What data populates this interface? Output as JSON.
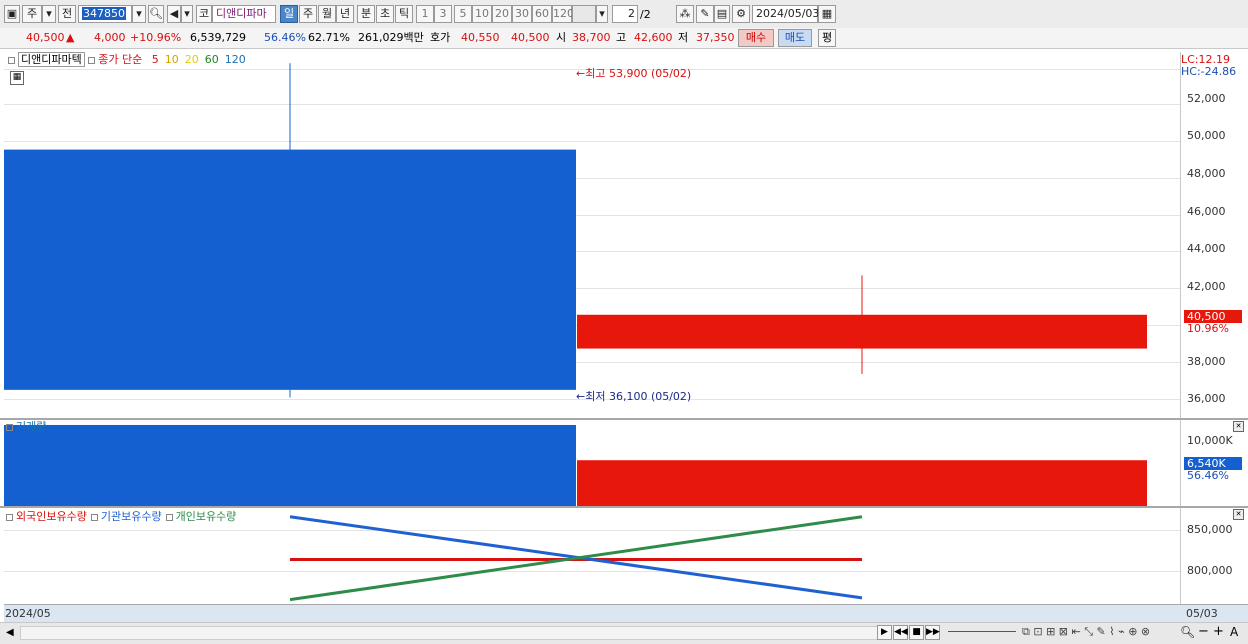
{
  "toolbar": {
    "market": "주",
    "prev_label": "전",
    "stock_code": "347850",
    "code_prefix": "코",
    "stock_name": "디앤디파마",
    "periods": [
      "일",
      "주",
      "월",
      "년",
      "분",
      "초",
      "틱"
    ],
    "intervals": [
      "1",
      "3",
      "5",
      "10",
      "20",
      "30",
      "60",
      "120"
    ],
    "page": "2",
    "page_total": "/2",
    "date": "2024/05/03"
  },
  "quote": {
    "price": "40,500",
    "arrow": "▲",
    "change": "4,000",
    "change_pct": "+10.96%",
    "volume": "6,539,729",
    "volume_ratio": "56.46%",
    "turnover": "62.71%",
    "amount": "261,029백만",
    "hoga_label": "호가",
    "ask": "40,550",
    "bid": "40,500",
    "open_label": "시",
    "open": "38,700",
    "high_label": "고",
    "high": "42,600",
    "low_label": "저",
    "low": "37,350",
    "buy_label": "매수",
    "sell_label": "매도",
    "eval_label": "평"
  },
  "price_panel": {
    "legend_name": "디앤디파마텍",
    "legend_ma": "종가 단순",
    "ma_periods": [
      "5",
      "10",
      "20",
      "60",
      "120"
    ],
    "ma_colors": [
      "#d81010",
      "#d8a000",
      "#e0d000",
      "#1f8a1f",
      "#1a6fb0"
    ],
    "lc": "LC:12.19",
    "hc": "HC:-24.86",
    "high_annot": "최고 53,900 (05/02)",
    "low_annot": "최저 36,100 (05/02)",
    "last_price_tag": "40,500",
    "last_pct_tag": "10.96%",
    "y_ticks": [
      "52,000",
      "50,000",
      "48,000",
      "46,000",
      "44,000",
      "42,000",
      "38,000",
      "36,000"
    ]
  },
  "volume_panel": {
    "title": "거래량",
    "y_tick": "10,000K",
    "last_tag": "6,540K",
    "last_pct": "56.46%"
  },
  "holdings_panel": {
    "series_labels": [
      "외국인보유수량",
      "기관보유수량",
      "개인보유수량"
    ],
    "series_colors": [
      "#d81010",
      "#2060d0",
      "#2e8b4a"
    ],
    "y_ticks": [
      "850,000",
      "800,000"
    ]
  },
  "date_axis": {
    "left": "2024/05",
    "right": "05/03"
  },
  "chart_data": [
    {
      "type": "candlestick",
      "categories": [
        "05/02",
        "05/03"
      ],
      "series": [
        {
          "name": "05/02",
          "open": 49300,
          "high": 53900,
          "low": 36100,
          "close": 36500
        },
        {
          "name": "05/03",
          "open": 38700,
          "high": 42600,
          "low": 37350,
          "close": 40500
        }
      ],
      "ylim": [
        35000,
        54500
      ],
      "colors": {
        "up": "#e8170c",
        "down": "#1560d0"
      }
    },
    {
      "type": "bar",
      "title": "거래량",
      "categories": [
        "05/02",
        "05/03"
      ],
      "values": [
        11575000,
        6539729
      ],
      "ylim": [
        0,
        12000000
      ]
    },
    {
      "type": "line",
      "categories": [
        "05/02",
        "05/03"
      ],
      "series": [
        {
          "name": "외국인보유수량",
          "values": [
            811000,
            811000
          ]
        },
        {
          "name": "기관보유수량",
          "values": [
            860000,
            767000
          ]
        },
        {
          "name": "개인보유수량",
          "values": [
            765000,
            860000
          ]
        }
      ],
      "ylim": [
        760000,
        870000
      ]
    }
  ]
}
